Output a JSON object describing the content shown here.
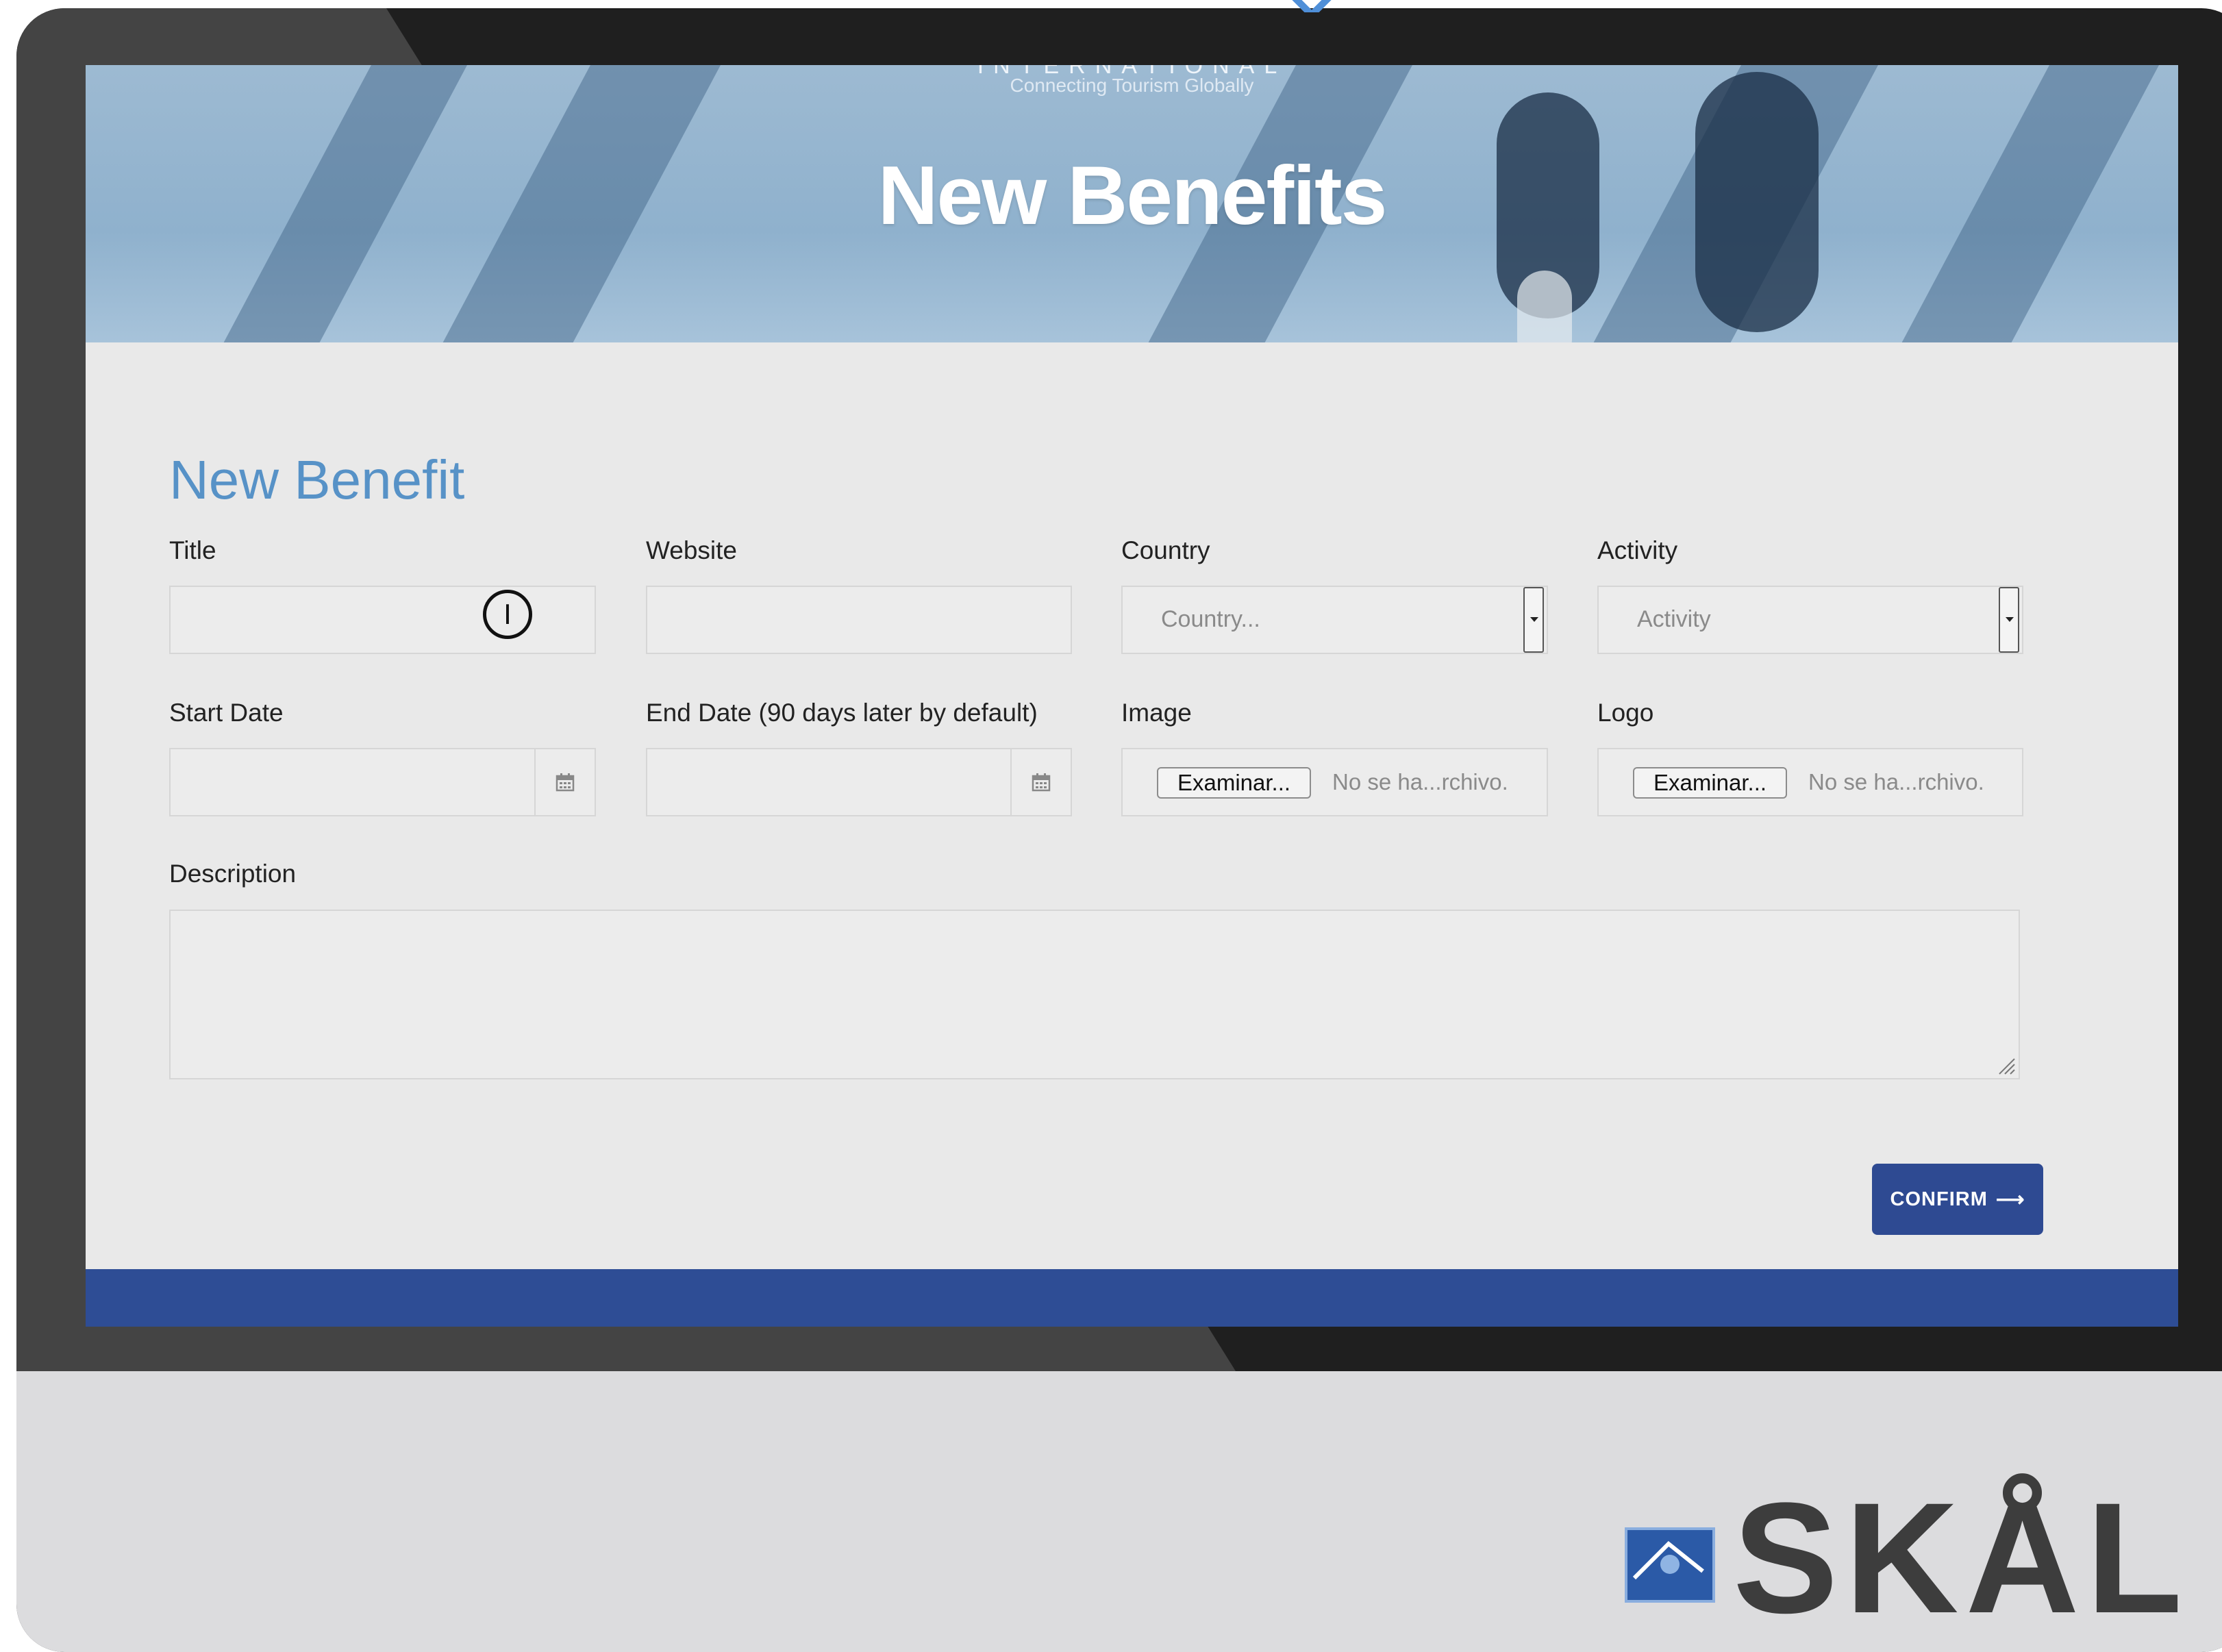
{
  "hero": {
    "brand_top": "INTERNATIONAL",
    "brand_tagline": "Connecting Tourism Globally",
    "title": "New Benefits"
  },
  "form": {
    "heading": "New Benefit",
    "title_label": "Title",
    "website_label": "Website",
    "country_label": "Country",
    "country_placeholder": "Country...",
    "activity_label": "Activity",
    "activity_placeholder": "Activity",
    "start_date_label": "Start Date",
    "end_date_label": "End Date (90 days later by default)",
    "image_label": "Image",
    "logo_label": "Logo",
    "file_button": "Examinar...",
    "file_status": "No se ha...rchivo.",
    "description_label": "Description",
    "confirm_label": "CONFIRM",
    "confirm_arrow": "⟶"
  },
  "logo": {
    "text": "SKÅL"
  },
  "colors": {
    "accent_heading": "#5792c7",
    "confirm_button": "#2e4a92",
    "footer_bar": "#2e4d95"
  }
}
